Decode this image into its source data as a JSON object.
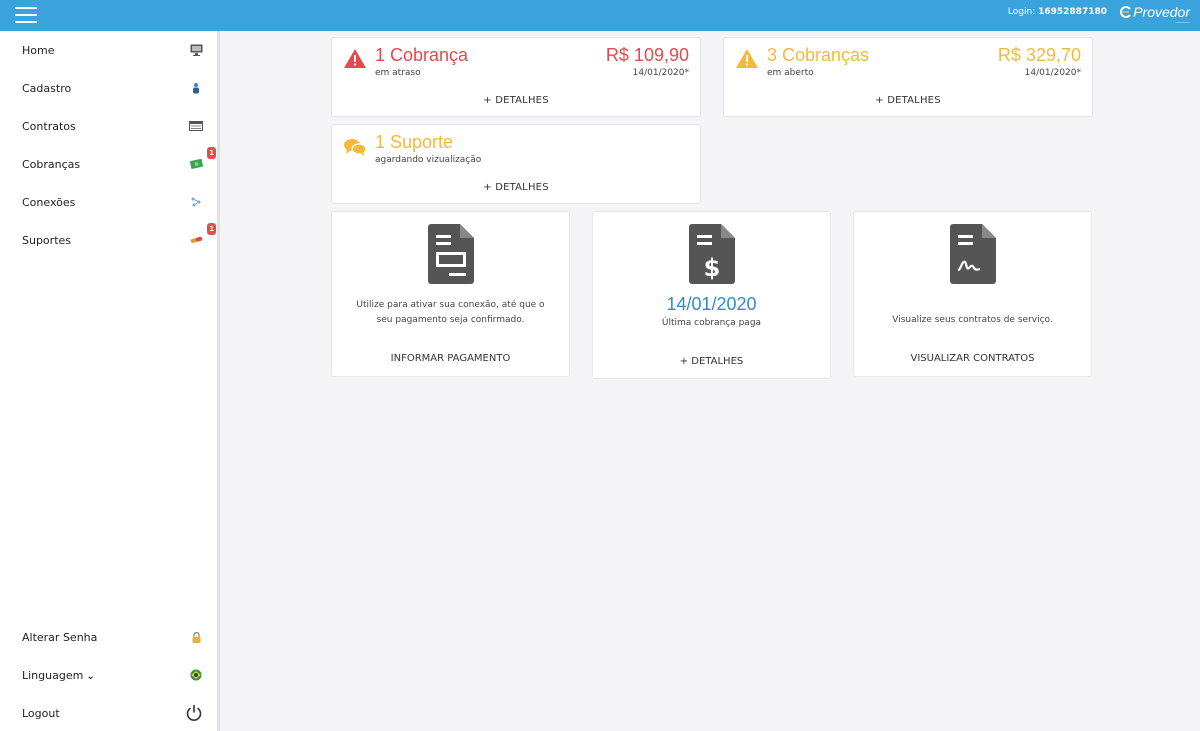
{
  "header": {
    "login_label": "Login:",
    "login_value": "16952887180",
    "brand": "Provedor",
    "brand_sub": "———"
  },
  "sidebar": {
    "items": [
      {
        "label": "Home",
        "icon": "monitor-icon"
      },
      {
        "label": "Cadastro",
        "icon": "user-icon"
      },
      {
        "label": "Contratos",
        "icon": "contract-icon"
      },
      {
        "label": "Cobranças",
        "icon": "money-icon",
        "badge": "1"
      },
      {
        "label": "Conexões",
        "icon": "connection-icon"
      },
      {
        "label": "Suportes",
        "icon": "support-icon",
        "badge": "1"
      }
    ],
    "bottom": [
      {
        "label": "Alterar Senha",
        "icon": "lock-icon"
      },
      {
        "label": "Linguagem",
        "icon": "brazil-flag-icon"
      },
      {
        "label": "Logout",
        "icon": "power-icon"
      }
    ]
  },
  "alerts": {
    "overdue": {
      "title": "1 Cobrança",
      "subtitle": "em atraso",
      "amount": "R$ 109,90",
      "date": "14/01/2020*",
      "link": "+ DETALHES",
      "color": "#e5494d"
    },
    "open": {
      "title": "3 Cobranças",
      "subtitle": "em aberto",
      "amount": "R$ 329,70",
      "date": "14/01/2020*",
      "link": "+ DETALHES",
      "color": "#f5b93a"
    },
    "support": {
      "title": "1 Suporte",
      "subtitle": "agardando vizualização",
      "link": "+ DETALHES",
      "color": "#f5b93a"
    }
  },
  "cards": {
    "payment": {
      "text_line1": "Utilize para ativar sua conexão, até que o",
      "text_line2": "seu pagamento seja confirmado.",
      "action": "INFORMAR PAGAMENTO"
    },
    "last_paid": {
      "date": "14/01/2020",
      "label": "Última cobrança paga",
      "action": "+ DETALHES"
    },
    "contracts": {
      "text": "Visualize seus contratos de serviço.",
      "action": "VISUALIZAR CONTRATOS"
    }
  },
  "colors": {
    "topbar": "#3aa3de",
    "danger": "#e5494d",
    "warning": "#f5b93a",
    "accent": "#2f8ec9"
  }
}
